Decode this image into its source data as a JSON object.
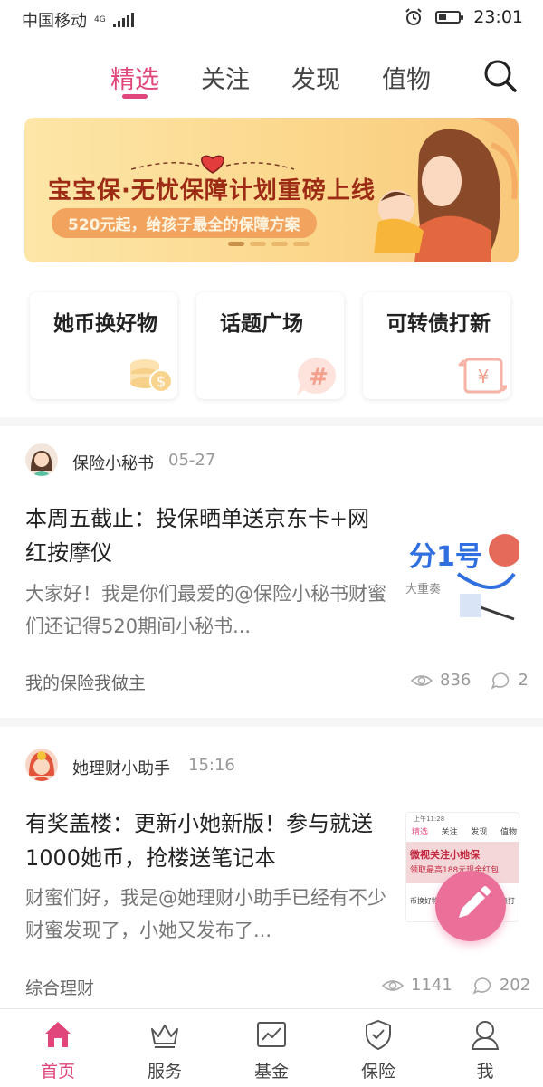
{
  "status_bar": {
    "carrier": "中国移动",
    "network": "4G",
    "time": "23:01"
  },
  "top_tabs": {
    "items": [
      {
        "label": "精选",
        "active": true
      },
      {
        "label": "关注",
        "active": false
      },
      {
        "label": "发现",
        "active": false
      },
      {
        "label": "值物",
        "active": false
      }
    ],
    "search_icon": "search-icon",
    "accent": "#e0457b"
  },
  "banner": {
    "title": "宝宝保·无忧保障计划重磅上线",
    "subtitle": "520元起，给孩子最全的保障方案",
    "slide_count": 4,
    "active_slide": 1
  },
  "quick_links": [
    {
      "label": "她币换好物",
      "icon": "coins-icon"
    },
    {
      "label": "话题广场",
      "icon": "hashtag-bubble-icon"
    },
    {
      "label": "可转债打新",
      "icon": "yuan-exchange-icon"
    }
  ],
  "posts": [
    {
      "author": "保险小秘书",
      "time": "05-27",
      "title": "本周五截止：投保晒单送京东卡+网红按摩仪",
      "excerpt": "大家好！我是你们最爱的@保险小秘书财蜜们还记得520期间小秘书...",
      "tag": "我的保险我做主",
      "views": "836",
      "comments": "2",
      "thumb_text": "分1号",
      "thumb_sub": "大重奏"
    },
    {
      "author": "她理财小助手",
      "time": "15:16",
      "title": "有奖盖楼：更新小她新版！参与就送1000她币，抢楼送笔记本",
      "excerpt": "财蜜们好，我是@她理财小助手已经有不少财蜜发现了，小她又发布了...",
      "tag": "综合理财",
      "views": "1141",
      "comments": "202",
      "thumb_status_left": "上午11:28",
      "thumb_tabs": [
        "精选",
        "关注",
        "发现",
        "值物"
      ],
      "thumb_line1": "微视关注小她保",
      "thumb_line2": "领取最高188元现金红包",
      "thumb_bottom_left": "币换好物",
      "thumb_bottom_right": "债打"
    }
  ],
  "fab": {
    "icon": "pencil-icon",
    "color": "#ea6f99"
  },
  "bottom_nav": [
    {
      "label": "首页",
      "icon": "home-icon",
      "active": true
    },
    {
      "label": "服务",
      "icon": "crown-icon",
      "active": false
    },
    {
      "label": "基金",
      "icon": "chart-icon",
      "active": false
    },
    {
      "label": "保险",
      "icon": "shield-check-icon",
      "active": false
    },
    {
      "label": "我",
      "icon": "person-icon",
      "active": false
    }
  ]
}
